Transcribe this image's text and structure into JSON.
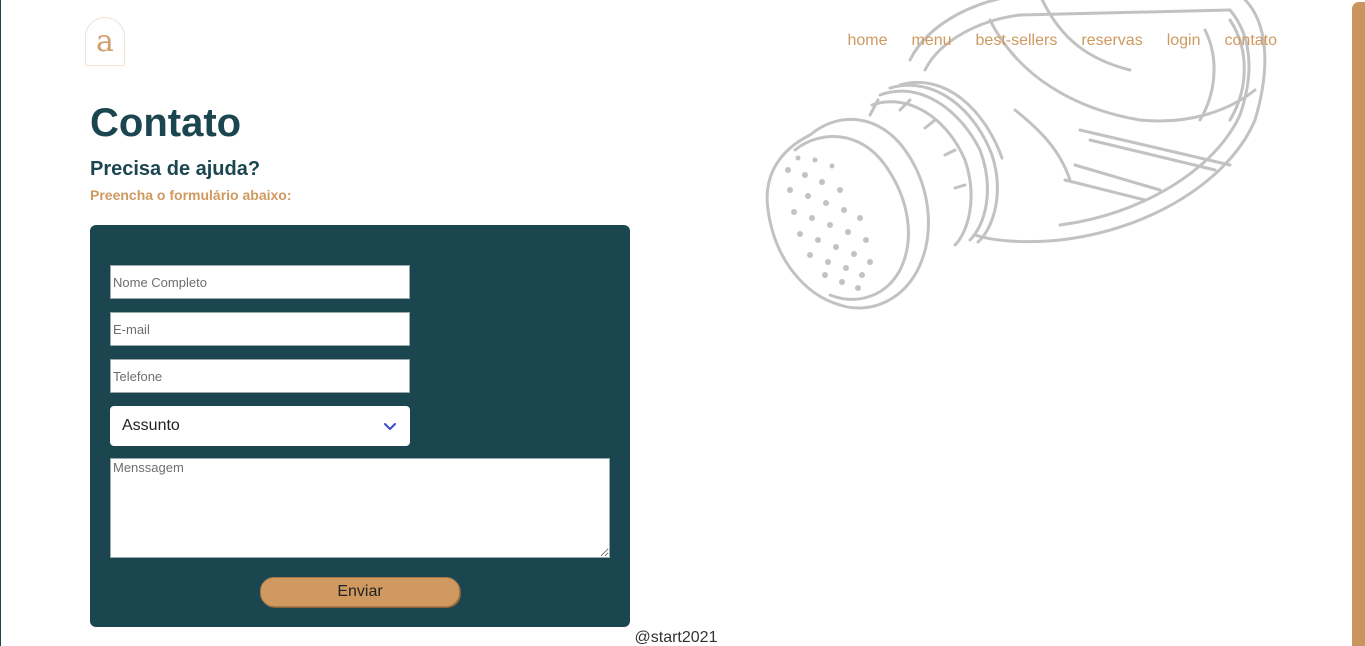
{
  "brand": {
    "logo_letter": "a"
  },
  "nav": {
    "items": [
      "home",
      "menu",
      "best-sellers",
      "reservas",
      "login",
      "contato"
    ]
  },
  "header": {
    "title": "Contato",
    "subtitle": "Precisa de ajuda?",
    "instruction": "Preencha o formulário abaixo:"
  },
  "form": {
    "name_placeholder": "Nome Completo",
    "email_placeholder": "E-mail",
    "phone_placeholder": "Telefone",
    "subject_selected": "Assunto",
    "message_placeholder": "Menssagem",
    "submit_label": "Enviar"
  },
  "footer": {
    "text": "@start2021"
  },
  "colors": {
    "primary_dark": "#1b4650",
    "accent_gold": "#cf995f",
    "background": "#ffffff"
  },
  "icons": {
    "select_arrow": "chevron-down-icon",
    "decoration": "salt-shaker-illustration"
  }
}
